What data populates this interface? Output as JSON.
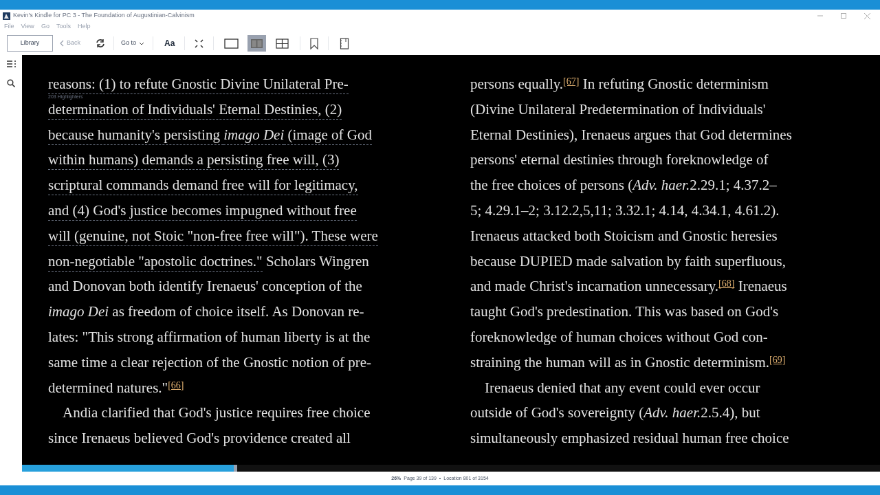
{
  "window": {
    "title": "Kevin's Kindle for PC 3 - The Foundation of Augustinian-Calvinism"
  },
  "menu": [
    "File",
    "View",
    "Go",
    "Tools",
    "Help"
  ],
  "toolbar": {
    "library": "Library",
    "back": {
      "label": "Back",
      "disabled": true
    },
    "goto": "Go to",
    "font": "Aa",
    "layouts": [
      {
        "kind": "single",
        "selected": false
      },
      {
        "kind": "two",
        "selected": true
      },
      {
        "kind": "grid",
        "selected": false
      }
    ]
  },
  "popular_highlight": "203 Highlighters",
  "columns": [
    [
      {
        "indent": false,
        "lines": [
          [
            {
              "t": "reasons: (1) to refute Gnostic Divine Unilateral Pre-",
              "kind": "text",
              "highlighted": true
            }
          ],
          [
            {
              "t": "determination of Individuals' Eternal Destinies, (2)",
              "kind": "text",
              "highlighted": true
            }
          ],
          [
            {
              "t": "because humanity's persisting ",
              "kind": "text",
              "highlighted": true
            },
            {
              "t": "imago Dei",
              "kind": "italic",
              "highlighted": true
            },
            {
              "t": " (image of God",
              "kind": "text",
              "highlighted": true
            }
          ],
          [
            {
              "t": "within humans) demands a persisting free will, (3)",
              "kind": "text",
              "highlighted": true
            }
          ],
          [
            {
              "t": "scriptural commands demand free will for legitimacy,",
              "kind": "text",
              "highlighted": true
            }
          ],
          [
            {
              "t": "and (4) God's justice becomes impugned without free",
              "kind": "text",
              "highlighted": true
            }
          ],
          [
            {
              "t": "will (genuine, not Stoic \"non-free free will\"). These were",
              "kind": "text",
              "highlighted": true
            }
          ],
          [
            {
              "t": "non-negotiable \"apostolic doctrines.\"",
              "kind": "text",
              "highlighted": true
            },
            {
              "t": " Scholars Wingren",
              "kind": "text",
              "highlighted": false
            }
          ],
          [
            {
              "t": "and Donovan both identify Irenaeus' conception of the",
              "kind": "text",
              "highlighted": false
            }
          ],
          [
            {
              "t": "imago Dei",
              "kind": "italic",
              "highlighted": false
            },
            {
              "t": " as freedom of choice itself. As Donovan re-",
              "kind": "text",
              "highlighted": false
            }
          ],
          [
            {
              "t": "lates: \"This strong affirmation of human liberty is at the",
              "kind": "text",
              "highlighted": false
            }
          ],
          [
            {
              "t": "same time a clear rejection of the Gnostic notion of pre-",
              "kind": "text",
              "highlighted": false
            }
          ],
          [
            {
              "t": "determined natures.\"",
              "kind": "text",
              "highlighted": false
            },
            {
              "t": "[66]",
              "kind": "ref",
              "highlighted": false
            }
          ]
        ]
      },
      {
        "indent": true,
        "lines": [
          [
            {
              "t": "Andia clarified that God's justice requires free choice",
              "kind": "text",
              "highlighted": false
            }
          ],
          [
            {
              "t": "since Irenaeus believed God's providence created all",
              "kind": "text",
              "highlighted": false
            }
          ]
        ]
      }
    ],
    [
      {
        "indent": false,
        "lines": [
          [
            {
              "t": "persons equally.",
              "kind": "text",
              "highlighted": false
            },
            {
              "t": "[67]",
              "kind": "ref",
              "highlighted": false
            },
            {
              "t": " In refuting Gnostic determinism",
              "kind": "text",
              "highlighted": false
            }
          ],
          [
            {
              "t": "(Divine Unilateral Predetermination of Individuals'",
              "kind": "text",
              "highlighted": false
            }
          ],
          [
            {
              "t": "Eternal Destinies), Irenaeus argues that God determines",
              "kind": "text",
              "highlighted": false
            }
          ],
          [
            {
              "t": "persons' eternal destinies through foreknowledge of",
              "kind": "text",
              "highlighted": false
            }
          ],
          [
            {
              "t": "the free choices of persons (",
              "kind": "text",
              "highlighted": false
            },
            {
              "t": "Adv. haer.",
              "kind": "italic",
              "highlighted": false
            },
            {
              "t": "2.29.1; 4.37.2–",
              "kind": "text",
              "highlighted": false
            }
          ],
          [
            {
              "t": "5; 4.29.1–2; 3.12.2,5,11; 3.32.1; 4.14, 4.34.1, 4.61.2).",
              "kind": "text",
              "highlighted": false
            }
          ],
          [
            {
              "t": "Irenaeus attacked both Stoicism and Gnostic heresies",
              "kind": "text",
              "highlighted": false
            }
          ],
          [
            {
              "t": "because DUPIED made salvation by faith superfluous,",
              "kind": "text",
              "highlighted": false
            }
          ],
          [
            {
              "t": "and made Christ's incarnation unnecessary.",
              "kind": "text",
              "highlighted": false
            },
            {
              "t": "[68]",
              "kind": "ref",
              "highlighted": false
            },
            {
              "t": " Irenaeus",
              "kind": "text",
              "highlighted": false
            }
          ],
          [
            {
              "t": "taught God's predestination. This was based on God's",
              "kind": "text",
              "highlighted": false
            }
          ],
          [
            {
              "t": "foreknowledge of human choices without God con-",
              "kind": "text",
              "highlighted": false
            }
          ],
          [
            {
              "t": "straining the human will as in Gnostic determinism.",
              "kind": "text",
              "highlighted": false
            },
            {
              "t": "[69]",
              "kind": "ref",
              "highlighted": false
            }
          ]
        ]
      },
      {
        "indent": true,
        "lines": [
          [
            {
              "t": "Irenaeus denied that any event could ever occur",
              "kind": "text",
              "highlighted": false
            }
          ],
          [
            {
              "t": "outside of God's sovereignty (",
              "kind": "text",
              "highlighted": false
            },
            {
              "t": "Adv. haer.",
              "kind": "italic",
              "highlighted": false
            },
            {
              "t": "2.5.4), but",
              "kind": "text",
              "highlighted": false
            }
          ],
          [
            {
              "t": "simultaneously emphasized residual human free choice",
              "kind": "text",
              "highlighted": false
            }
          ]
        ]
      }
    ]
  ],
  "progress": {
    "level": 0.247
  },
  "status": {
    "percent": "26%",
    "page": "Page 39 of 139",
    "separator": "•",
    "location": "Location 801 of 3154"
  }
}
